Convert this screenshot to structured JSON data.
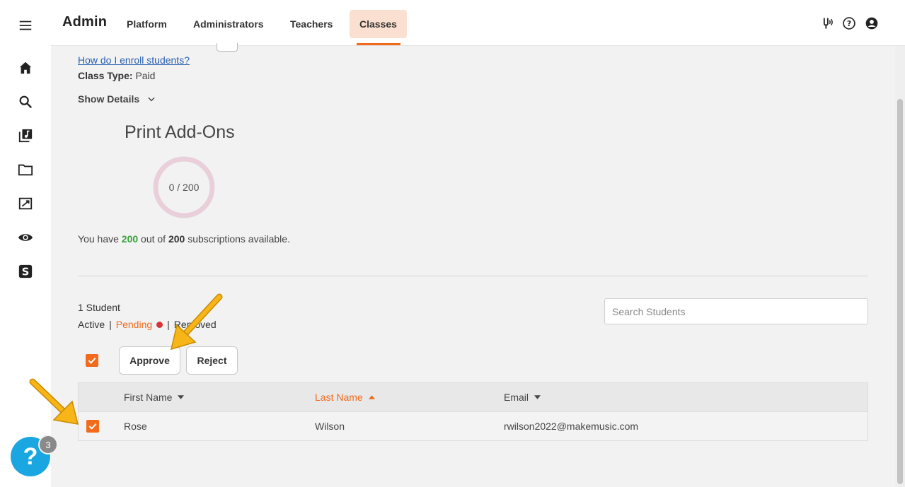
{
  "header": {
    "brand": "Admin",
    "tabs": [
      {
        "label": "Platform"
      },
      {
        "label": "Administrators"
      },
      {
        "label": "Teachers"
      },
      {
        "label": "Classes"
      }
    ],
    "active_tab": "Classes",
    "icons": [
      "tuning-fork-icon",
      "help-circle-icon",
      "account-icon"
    ]
  },
  "sidebar": {
    "icons": [
      "menu-icon",
      "home-icon",
      "search-icon",
      "music-library-icon",
      "folder-icon",
      "assignment-icon",
      "eye-icon",
      "s-logo-icon"
    ]
  },
  "class_info": {
    "enroll_link": "How do I enroll students?",
    "class_type_label": "Class Type:",
    "class_type_value": "Paid",
    "show_details": "Show Details"
  },
  "print_addons": {
    "title": "Print Add-Ons",
    "used": 0,
    "total": 200,
    "donut_text": "0 / 200",
    "subs_prefix": "You have",
    "subs_available": "200",
    "subs_middle": "out of",
    "subs_total": "200",
    "subs_suffix": "subscriptions available."
  },
  "students": {
    "count_label": "1 Student",
    "filters": {
      "active": "Active",
      "pending": "Pending",
      "removed": "Removed"
    },
    "search_placeholder": "Search Students",
    "actions": {
      "approve": "Approve",
      "reject": "Reject"
    },
    "columns": [
      {
        "label": "First Name",
        "sort": "desc"
      },
      {
        "label": "Last Name",
        "sort": "asc"
      },
      {
        "label": "Email",
        "sort": "desc"
      }
    ],
    "rows": [
      {
        "first": "Rose",
        "last": "Wilson",
        "email": "rwilson2022@makemusic.com",
        "checked": true
      }
    ]
  },
  "help_widget": {
    "glyph": "?",
    "badge": "3"
  },
  "colors": {
    "accent": "#f26a1b",
    "tab_active_bg": "#fbe0d2",
    "link": "#2a5fb0",
    "green": "#3aa33a",
    "help": "#1aa6e0",
    "arrow": "#f7b518"
  }
}
